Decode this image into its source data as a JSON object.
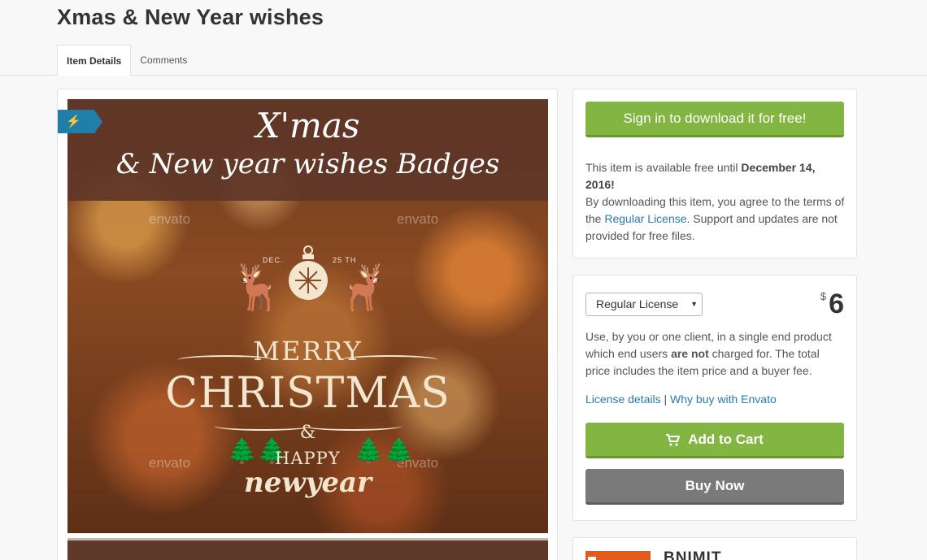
{
  "page": {
    "title": "Xmas & New Year wishes"
  },
  "tabs": [
    {
      "label": "Item Details",
      "active": true
    },
    {
      "label": "Comments",
      "active": false
    }
  ],
  "preview": {
    "banner_line1": "X'mas",
    "banner_line2": "& New year wishes Badges",
    "watermark": "envato",
    "dec_label": "DEC.",
    "day_label": "25 TH",
    "merry": "MERRY",
    "christmas": "CHRISTMAS",
    "amp": "&",
    "happy": "HAPPY",
    "newyear": "newyear",
    "flash_icon": "lightning-icon"
  },
  "free_panel": {
    "signin_button": "Sign in to download it for free!",
    "text_prefix": "This item is available free until ",
    "free_until": "December 14, 2016!",
    "text_agree": "By downloading this item, you agree to the terms of the ",
    "regular_license_link": "Regular License",
    "text_suffix": ". Support and updates are not provided for free files."
  },
  "purchase_panel": {
    "license_selected": "Regular License",
    "currency": "$",
    "price": "6",
    "desc_part1": "Use, by you or one client, in a single end product which end users ",
    "desc_bold": "are not",
    "desc_part2": " charged for. The total price includes the item price and a buyer fee.",
    "license_details_link": "License details",
    "separator": " | ",
    "why_buy_link": "Why buy with Envato",
    "add_to_cart": "Add to Cart",
    "buy_now": "Buy Now",
    "cart_icon": "cart-icon"
  },
  "author": {
    "name": "BNIMIT"
  },
  "colors": {
    "green": "#82b541",
    "gray_button": "#7a7a7a",
    "link": "#2a7ab0",
    "badge_blue": "#1f7fa8",
    "author_logo": "#e25a1c"
  }
}
